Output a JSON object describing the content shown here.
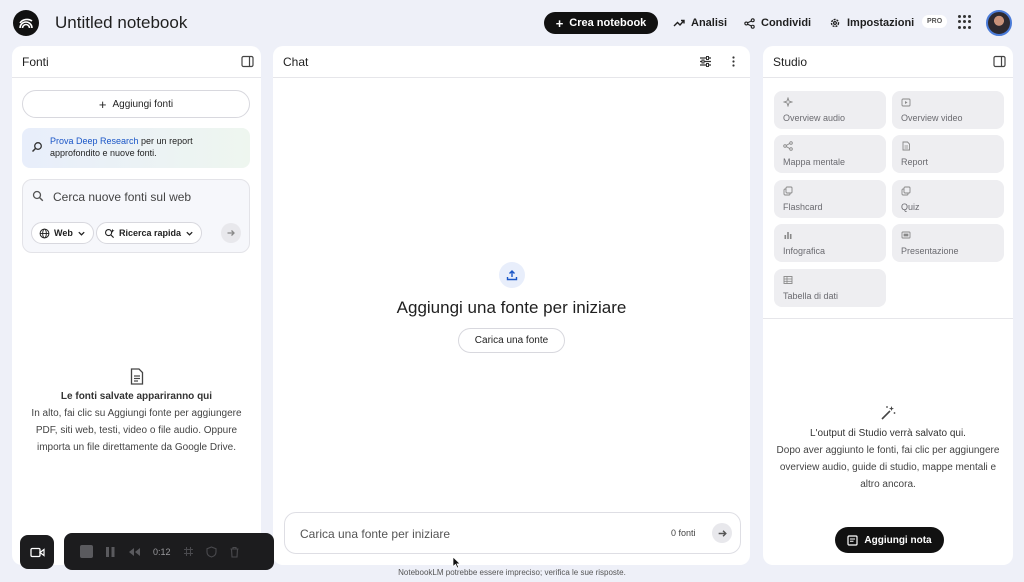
{
  "header": {
    "title": "Untitled notebook",
    "create_label": "Crea notebook",
    "analytics_label": "Analisi",
    "share_label": "Condividi",
    "settings_label": "Impostazioni",
    "pro_badge": "PRO"
  },
  "sources": {
    "title": "Fonti",
    "add_label": "Aggiungi fonti",
    "banner_link": "Prova Deep Research",
    "banner_rest": " per un report approfondito e nuove fonti.",
    "search_placeholder": "Cerca nuove fonti sul web",
    "chip_web": "Web",
    "chip_mode": "Ricerca rapida",
    "empty_title": "Le fonti salvate appariranno qui",
    "empty_body": "In alto, fai clic su Aggiungi fonte per aggiungere PDF, siti web, testi, video o file audio. Oppure importa un file direttamente da Google Drive."
  },
  "chat": {
    "title": "Chat",
    "heading": "Aggiungi una fonte per iniziare",
    "upload_label": "Carica una fonte",
    "input_placeholder": "Carica una fonte per iniziare",
    "source_count": "0 fonti"
  },
  "studio": {
    "title": "Studio",
    "tiles": [
      {
        "label": "Overview audio",
        "icon": "sparkle-wave-icon"
      },
      {
        "label": "Overview video",
        "icon": "video-icon"
      },
      {
        "label": "Mappa mentale",
        "icon": "mind-map-icon"
      },
      {
        "label": "Report",
        "icon": "report-icon"
      },
      {
        "label": "Flashcard",
        "icon": "flashcard-icon"
      },
      {
        "label": "Quiz",
        "icon": "quiz-icon"
      },
      {
        "label": "Infografica",
        "icon": "infographic-icon"
      },
      {
        "label": "Presentazione",
        "icon": "slides-icon"
      },
      {
        "label": "Tabella di dati",
        "icon": "table-icon"
      }
    ],
    "empty_title": "L'output di Studio verrà salvato qui.",
    "empty_body": "Dopo aver aggiunto le fonti, fai clic per aggiungere overview audio, guide di studio, mappe mentali e altro ancora.",
    "add_note_label": "Aggiungi nota"
  },
  "footer": {
    "disclaimer": "NotebookLM potrebbe essere impreciso; verifica le sue risposte."
  },
  "recorder": {
    "elapsed": "0:12"
  }
}
